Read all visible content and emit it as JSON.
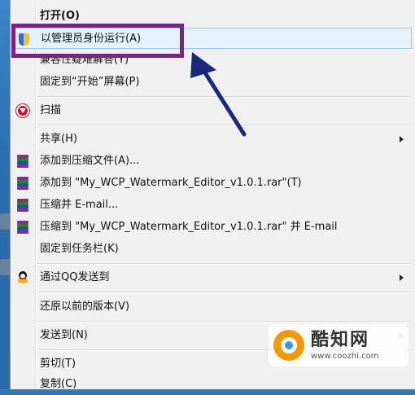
{
  "menu": {
    "items": [
      {
        "label": "打开(O)",
        "icon": "none",
        "submenu": false
      },
      {
        "label": "以管理员身份运行(A)",
        "icon": "uac-shield-icon",
        "submenu": false,
        "highlighted": true
      },
      {
        "label": "兼容性疑难解答(Y)",
        "icon": "none",
        "submenu": false
      },
      {
        "label": "固定到“开始”屏幕(P)",
        "icon": "none",
        "submenu": false
      },
      {
        "label": "扫描",
        "icon": "mcafee-icon",
        "submenu": false
      },
      {
        "label": "共享(H)",
        "icon": "none",
        "submenu": true
      },
      {
        "label": "添加到压缩文件(A)...",
        "icon": "winrar-icon",
        "submenu": false
      },
      {
        "label": "添加到 \"My_WCP_Watermark_Editor_v1.0.1.rar\"(T)",
        "icon": "winrar-icon",
        "submenu": false
      },
      {
        "label": "压缩并 E-mail...",
        "icon": "winrar-icon",
        "submenu": false
      },
      {
        "label": "压缩到 \"My_WCP_Watermark_Editor_v1.0.1.rar\" 并 E-mail",
        "icon": "winrar-icon",
        "submenu": false
      },
      {
        "label": "固定到任务栏(K)",
        "icon": "none",
        "submenu": false
      },
      {
        "label": "通过QQ发送到",
        "icon": "qq-icon",
        "submenu": true
      },
      {
        "label": "还原以前的版本(V)",
        "icon": "none",
        "submenu": false
      },
      {
        "label": "发送到(N)",
        "icon": "none",
        "submenu": true
      },
      {
        "label": "剪切(T)",
        "icon": "none",
        "submenu": false
      },
      {
        "label": "复制(C)",
        "icon": "none",
        "submenu": false
      }
    ]
  },
  "watermark": {
    "brand": "酷知网",
    "url": "www.coozhi.com"
  },
  "colors": {
    "highlight_box": "#7a2286",
    "arrow": "#1a2a7a",
    "menu_background": "#f0f0f0",
    "hover_background": "#e5f1fb"
  }
}
